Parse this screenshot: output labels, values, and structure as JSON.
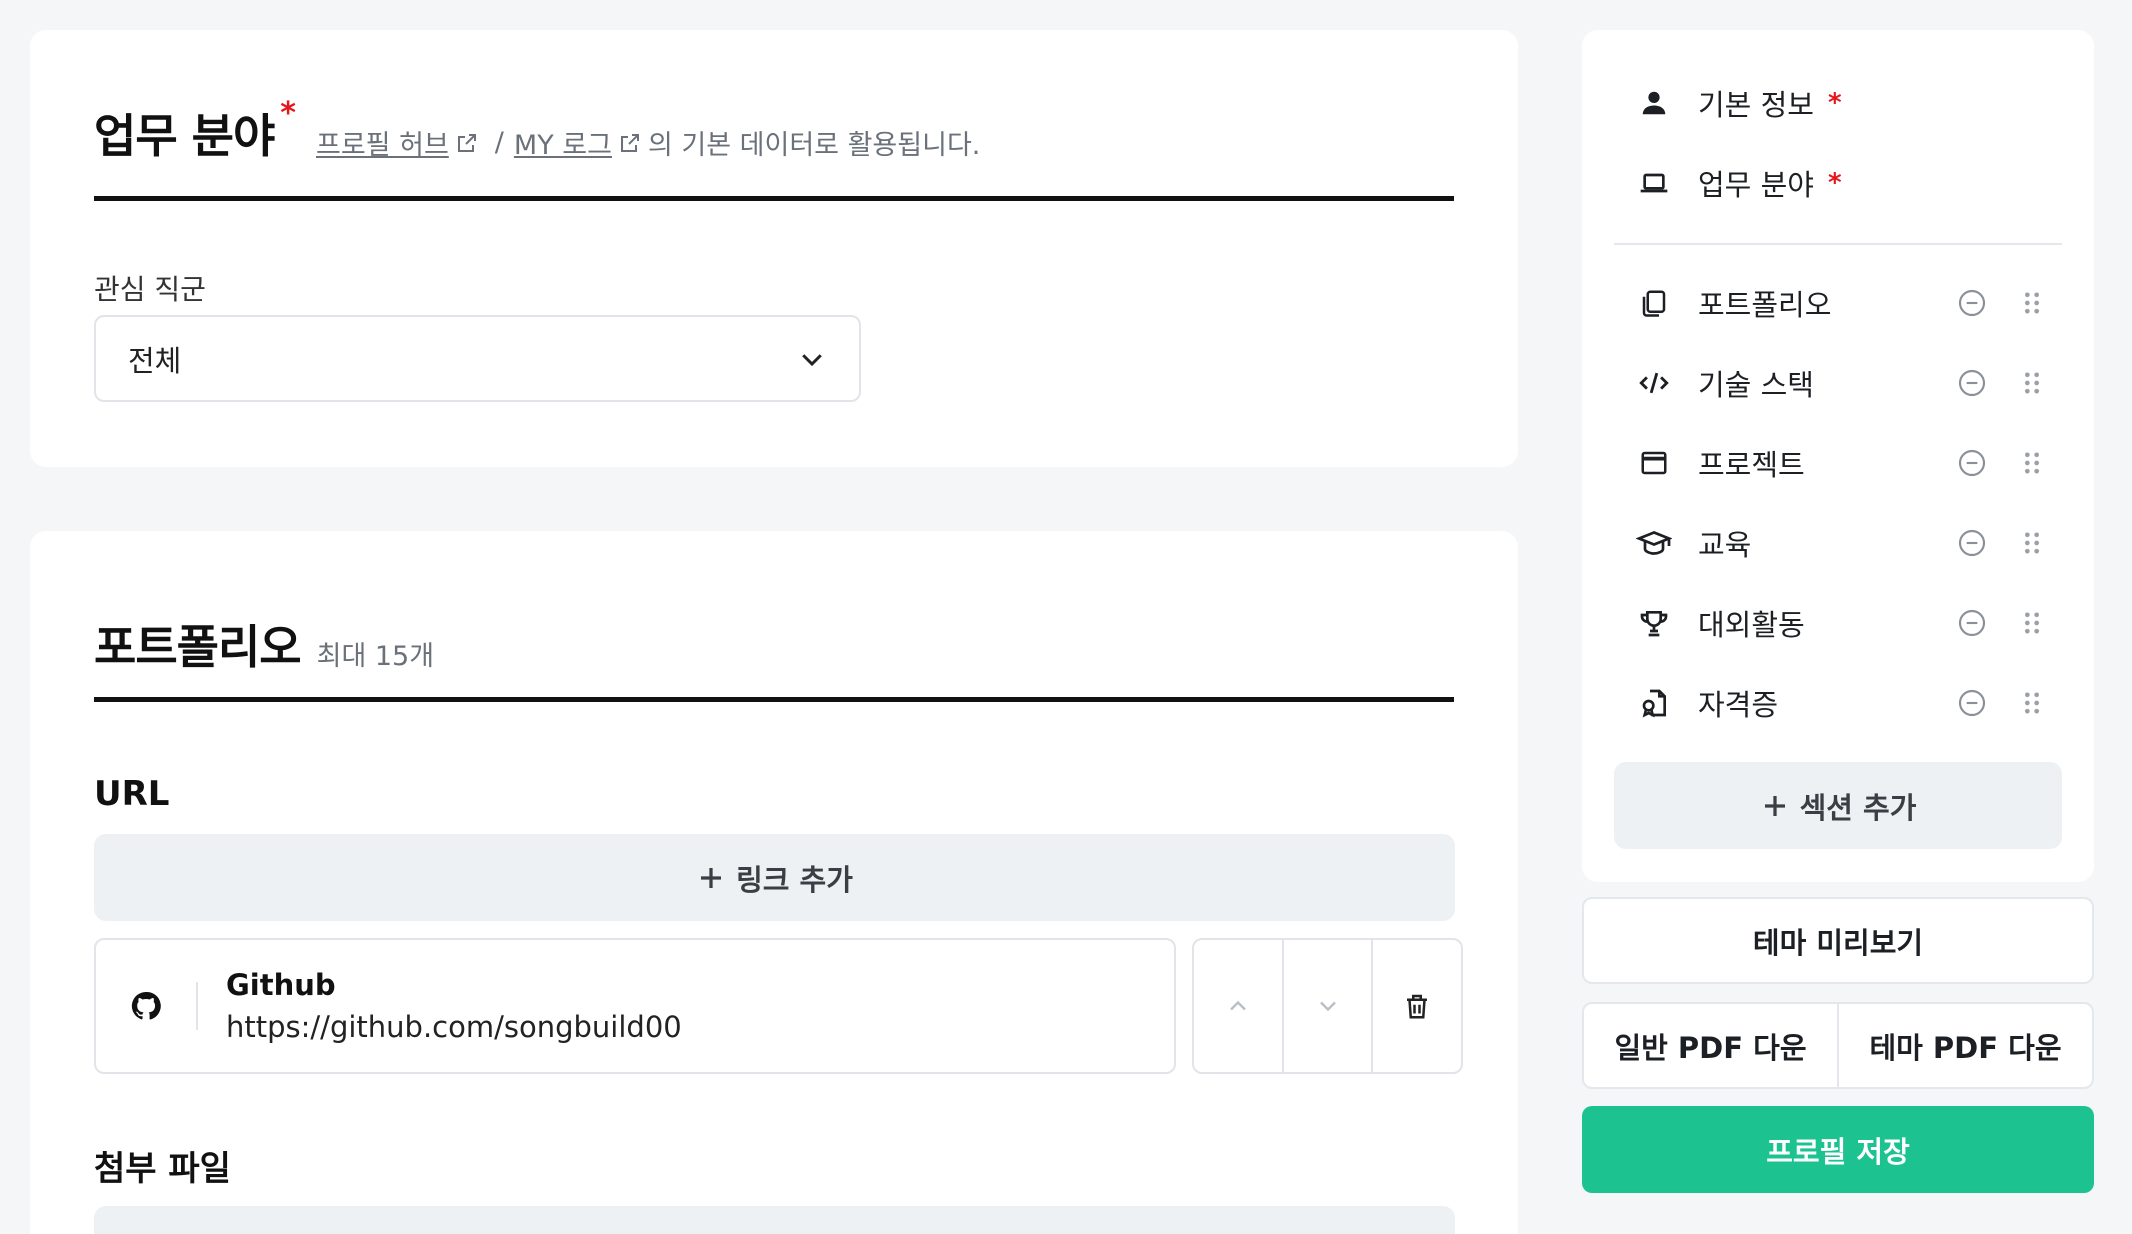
{
  "work_section": {
    "title": "업무 분야",
    "required_mark": "*",
    "note_link1": "프로필 허브",
    "note_sep": "/",
    "note_link2": "MY 로그",
    "note_tail": "의 기본 데이터로 활용됩니다.",
    "field_label": "관심 직군",
    "select_value": "전체"
  },
  "portfolio_section": {
    "title": "포트폴리오",
    "count_note": "최대 15개",
    "url_title": "URL",
    "add_link_label": "링크 추가",
    "links": [
      {
        "name": "Github",
        "url": "https://github.com/songbuild00",
        "icon": "github-icon"
      }
    ],
    "attachment_title": "첨부 파일"
  },
  "side_nav": {
    "items": [
      {
        "label": "기본 정보",
        "icon": "person-icon",
        "required": "*"
      },
      {
        "label": "업무 분야",
        "icon": "laptop-icon",
        "required": "*"
      },
      {
        "label": "포트폴리오",
        "icon": "copy-icon"
      },
      {
        "label": "기술 스택",
        "icon": "code-icon"
      },
      {
        "label": "프로젝트",
        "icon": "window-icon"
      },
      {
        "label": "교육",
        "icon": "graduation-cap-icon"
      },
      {
        "label": "대외활동",
        "icon": "trophy-icon"
      },
      {
        "label": "자격증",
        "icon": "certificate-icon"
      }
    ],
    "add_section_label": "섹션 추가"
  },
  "actions": {
    "theme_preview": "테마 미리보기",
    "normal_pdf": "일반 PDF 다운",
    "theme_pdf": "테마 PDF 다운",
    "save": "프로필 저장"
  },
  "colors": {
    "accent": "#1cc391",
    "required": "#e5161d",
    "background": "#f5f6f7"
  }
}
